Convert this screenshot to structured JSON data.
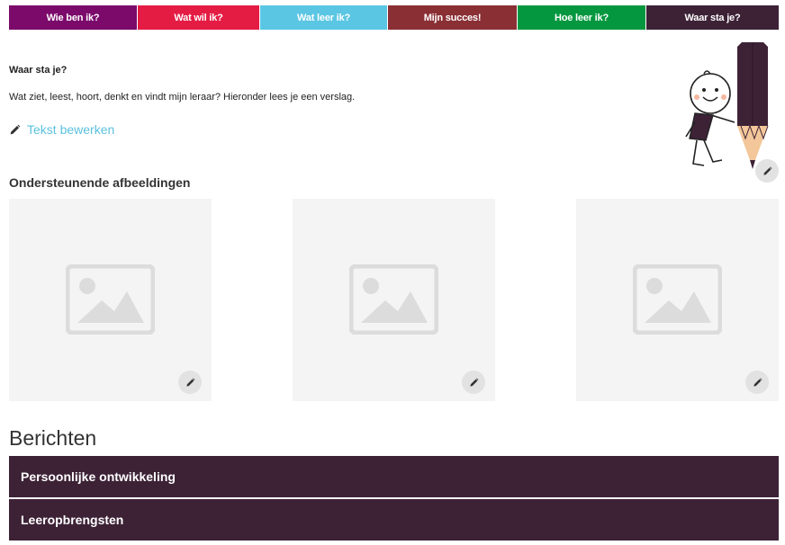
{
  "tabs": [
    {
      "label": "Wie ben ik?",
      "color": "#7b0a6b"
    },
    {
      "label": "Wat wil ik?",
      "color": "#e41c44"
    },
    {
      "label": "Wat leer ik?",
      "color": "#5bc6e3"
    },
    {
      "label": "Mijn succes!",
      "color": "#8a2f34"
    },
    {
      "label": "Hoe leer ik?",
      "color": "#05973f"
    },
    {
      "label": "Waar sta je?",
      "color": "#3d2236",
      "active": true
    }
  ],
  "section": {
    "title": "Waar sta je?",
    "description": "Wat ziet, leest, hoort, denkt en vindt mijn leraar? Hieronder lees je een verslag.",
    "edit_link": "Tekst bewerken"
  },
  "images": {
    "heading": "Ondersteunende afbeeldingen",
    "slots": [
      {
        "icon": "image-placeholder-icon"
      },
      {
        "icon": "image-placeholder-icon"
      },
      {
        "icon": "image-placeholder-icon"
      }
    ]
  },
  "messages": {
    "heading": "Berichten",
    "items": [
      {
        "label": "Persoonlijke ontwikkeling"
      },
      {
        "label": "Leeropbrengsten"
      }
    ]
  },
  "colors": {
    "accent": "#5bc0de",
    "accordion": "#3d2236",
    "placeholder_bg": "#f4f4f4"
  }
}
